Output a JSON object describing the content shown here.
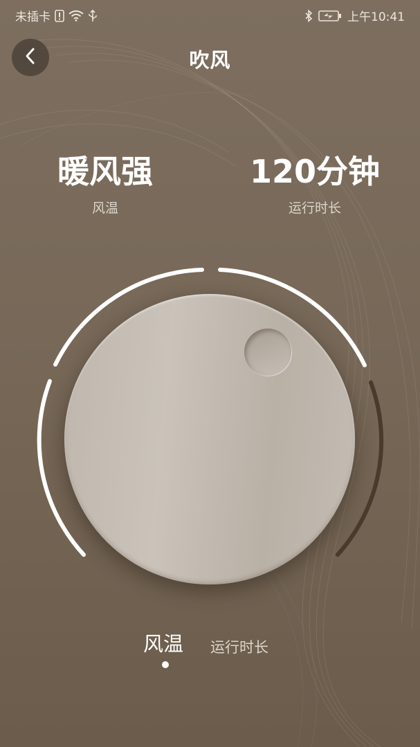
{
  "status_bar": {
    "carrier": "未插卡",
    "time": "上午10:41"
  },
  "header": {
    "title": "吹风"
  },
  "stats": {
    "wind_temp": {
      "value": "暖风强",
      "label": "风温"
    },
    "run_time": {
      "value": "120分钟",
      "label": "运行时长"
    }
  },
  "tabs": [
    {
      "label": "风温",
      "selected": true
    },
    {
      "label": "运行时长",
      "selected": false
    }
  ],
  "icons": {
    "back": "chevron-left-icon",
    "sim": "sim-alert-icon",
    "wifi": "wifi-icon",
    "usb": "usb-icon",
    "bluetooth": "bluetooth-icon",
    "battery": "battery-charging-icon"
  },
  "colors": {
    "background": "#776858",
    "knob": "#c4bdb3",
    "arc_active": "#ffffff",
    "arc_inactive": "#4a3a2c"
  }
}
